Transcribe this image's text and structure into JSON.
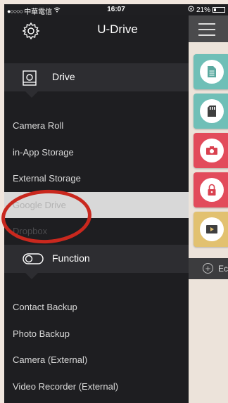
{
  "status_bar": {
    "carrier": "中華電信",
    "time": "16:07",
    "battery": "21%"
  },
  "sidebar": {
    "title": "U-Drive",
    "sections": [
      {
        "label": "Drive",
        "items": [
          {
            "label": "Camera Roll"
          },
          {
            "label": "in-App Storage"
          },
          {
            "label": "External Storage"
          },
          {
            "label": "Google Drive",
            "selected": true
          },
          {
            "label": "Dropbox"
          }
        ]
      },
      {
        "label": "Function",
        "items": [
          {
            "label": "Contact Backup"
          },
          {
            "label": "Photo Backup"
          },
          {
            "label": "Camera (External)"
          },
          {
            "label": "Video Recorder (External)"
          }
        ]
      }
    ]
  },
  "main": {
    "tiles": [
      {
        "icon": "document-icon",
        "color": "#6fbfb7"
      },
      {
        "icon": "sd-card-icon",
        "color": "#6fbfb7"
      },
      {
        "icon": "camera-icon",
        "color": "#e24b5b"
      },
      {
        "icon": "lock-icon",
        "color": "#e24b5b"
      },
      {
        "icon": "video-icon",
        "color": "#e2c170"
      }
    ],
    "bottom_label": "Ec"
  },
  "colors": {
    "accent_red": "#c9281e",
    "sidebar_bg": "#1e1e21"
  }
}
